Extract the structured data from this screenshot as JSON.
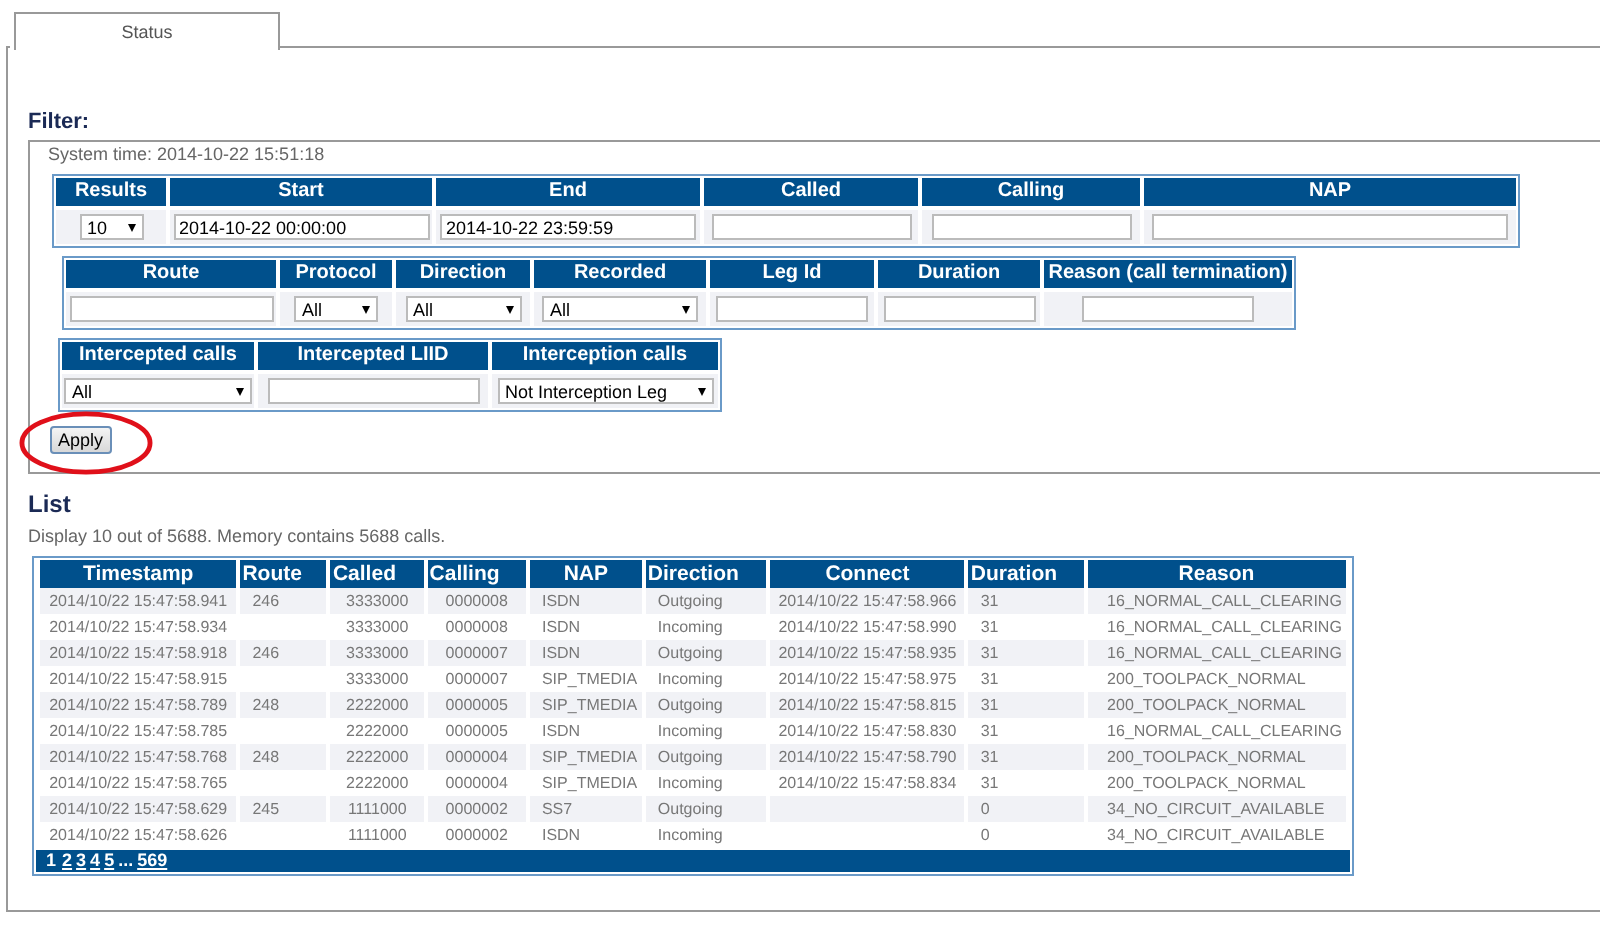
{
  "tab": {
    "label": "Status",
    "selected": true
  },
  "filter": {
    "title": "Filter:",
    "system_time": "System time: 2014-10-22 15:51:18",
    "groups": [
      [
        {
          "label": "Results",
          "kind": "select",
          "value": "10"
        },
        {
          "label": "Start",
          "kind": "text",
          "value": "2014-10-22 00:00:00"
        },
        {
          "label": "End",
          "kind": "text",
          "value": "2014-10-22 23:59:59"
        },
        {
          "label": "Called",
          "kind": "text"
        },
        {
          "label": "Calling",
          "kind": "text"
        },
        {
          "label": "NAP",
          "kind": "text"
        }
      ],
      [
        {
          "label": "Route",
          "kind": "text"
        },
        {
          "label": "Protocol",
          "kind": "select",
          "value": "All"
        },
        {
          "label": "Direction",
          "kind": "select",
          "value": "All"
        },
        {
          "label": "Recorded",
          "kind": "select",
          "value": "All"
        },
        {
          "label": "Leg Id",
          "kind": "text"
        },
        {
          "label": "Duration",
          "kind": "text"
        },
        {
          "label": "Reason (call termination)",
          "kind": "text"
        }
      ],
      [
        {
          "label": "Intercepted calls",
          "kind": "select",
          "value": "All"
        },
        {
          "label": "Intercepted LIID",
          "kind": "text"
        },
        {
          "label": "Interception calls",
          "kind": "select",
          "value": "Not Interception Leg"
        }
      ]
    ],
    "apply_button": "Apply",
    "apply_highlighted": true
  },
  "list": {
    "title": "List",
    "summary": "Display 10 out of 5688. Memory contains 5688 calls.",
    "columns": [
      "Timestamp",
      "Route",
      "Called",
      "Calling",
      "NAP",
      "Direction",
      "Connect",
      "Duration",
      "Reason"
    ],
    "rows": [
      [
        "2014/10/22 15:47:58.941",
        "246",
        "3333000",
        "0000008",
        "ISDN",
        "Outgoing",
        "2014/10/22 15:47:58.966",
        "31",
        "16_NORMAL_CALL_CLEARING"
      ],
      [
        "2014/10/22 15:47:58.934",
        null,
        "3333000",
        "0000008",
        "ISDN",
        "Incoming",
        "2014/10/22 15:47:58.990",
        "31",
        "16_NORMAL_CALL_CLEARING"
      ],
      [
        "2014/10/22 15:47:58.918",
        "246",
        "3333000",
        "0000007",
        "ISDN",
        "Outgoing",
        "2014/10/22 15:47:58.935",
        "31",
        "16_NORMAL_CALL_CLEARING"
      ],
      [
        "2014/10/22 15:47:58.915",
        null,
        "3333000",
        "0000007",
        "SIP_TMEDIA",
        "Incoming",
        "2014/10/22 15:47:58.975",
        "31",
        "200_TOOLPACK_NORMAL"
      ],
      [
        "2014/10/22 15:47:58.789",
        "248",
        "2222000",
        "0000005",
        "SIP_TMEDIA",
        "Outgoing",
        "2014/10/22 15:47:58.815",
        "31",
        "200_TOOLPACK_NORMAL"
      ],
      [
        "2014/10/22 15:47:58.785",
        null,
        "2222000",
        "0000005",
        "ISDN",
        "Incoming",
        "2014/10/22 15:47:58.830",
        "31",
        "16_NORMAL_CALL_CLEARING"
      ],
      [
        "2014/10/22 15:47:58.768",
        "248",
        "2222000",
        "0000004",
        "SIP_TMEDIA",
        "Outgoing",
        "2014/10/22 15:47:58.790",
        "31",
        "200_TOOLPACK_NORMAL"
      ],
      [
        "2014/10/22 15:47:58.765",
        null,
        "2222000",
        "0000004",
        "SIP_TMEDIA",
        "Incoming",
        "2014/10/22 15:47:58.834",
        "31",
        "200_TOOLPACK_NORMAL"
      ],
      [
        "2014/10/22 15:47:58.629",
        "245",
        "1111000",
        "0000002",
        "SS7",
        "Outgoing",
        null,
        "0",
        "34_NO_CIRCUIT_AVAILABLE"
      ],
      [
        "2014/10/22 15:47:58.626",
        null,
        "1111000",
        "0000002",
        "ISDN",
        "Incoming",
        null,
        "0",
        "34_NO_CIRCUIT_AVAILABLE"
      ]
    ],
    "pages": [
      {
        "label": "1",
        "selected": true
      },
      {
        "label": "2",
        "selected": false
      },
      {
        "label": "3",
        "selected": false
      },
      {
        "label": "4",
        "selected": false
      },
      {
        "label": "5",
        "selected": false
      },
      {
        "label": "...",
        "kind": "gap"
      },
      {
        "label": "569",
        "selected": false
      }
    ]
  }
}
